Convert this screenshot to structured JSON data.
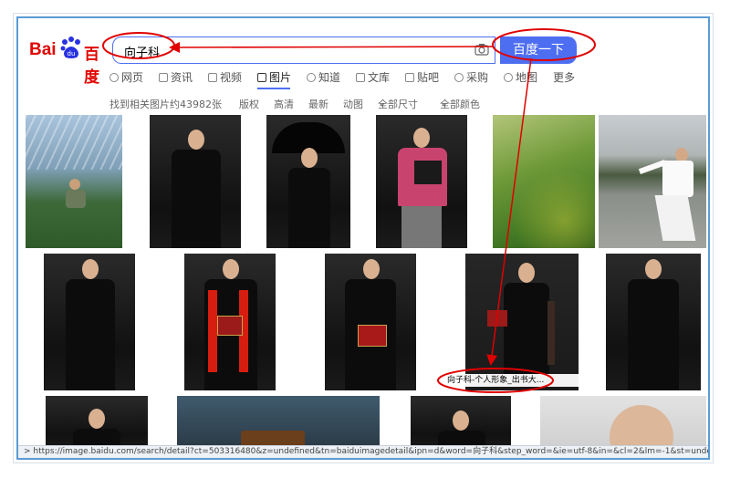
{
  "search": {
    "query": "向子科",
    "button_label": "百度一下"
  },
  "logo": {
    "bai": "Bai",
    "du": "百度",
    "paw_text": "du"
  },
  "tabs": [
    {
      "label": "网页"
    },
    {
      "label": "资讯"
    },
    {
      "label": "视频"
    },
    {
      "label": "图片"
    },
    {
      "label": "知道"
    },
    {
      "label": "文库"
    },
    {
      "label": "贴吧"
    },
    {
      "label": "采购"
    },
    {
      "label": "地图"
    },
    {
      "label": "更多"
    }
  ],
  "active_tab": "图片",
  "filters": {
    "result_count": "找到相关图片约43982张",
    "copyright": "版权",
    "hd": "高清",
    "latest": "最新",
    "animated": "动图",
    "size": "全部尺寸",
    "color": "全部颜色"
  },
  "caption": "向子科-个人形象_出书大...",
  "status_url": "https://image.baidu.com/search/detail?ct=503316480&z=undefined&tn=baiduimagedetail&ipn=d&word=向子科&step_word=&ie=utf-8&in=&cl=2&lm=-1&st=undef",
  "colors": {
    "accent": "#4e6ef2",
    "logo_red": "#e10602",
    "annotation": "#e00000"
  }
}
